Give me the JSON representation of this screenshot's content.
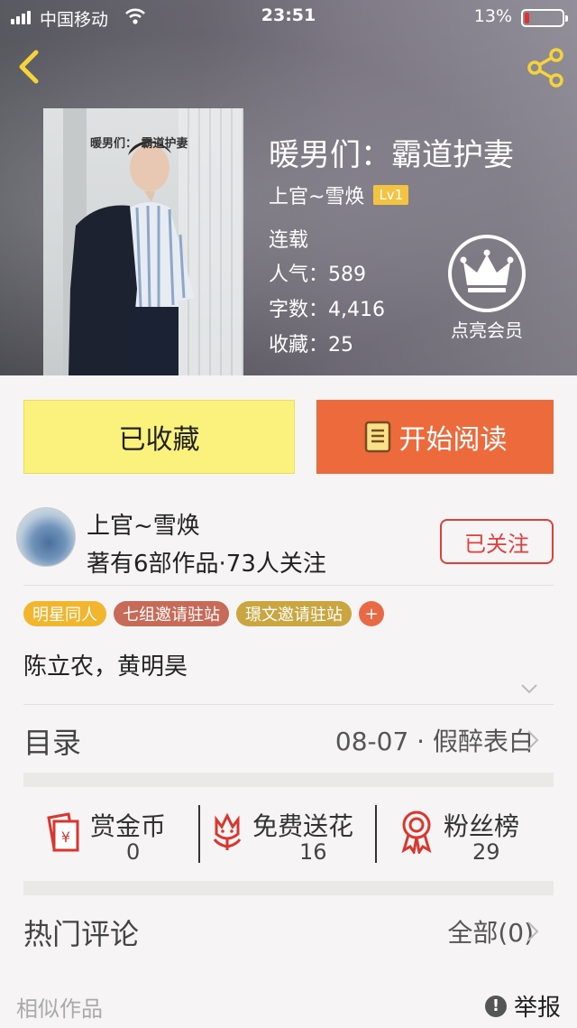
{
  "status_bar": {
    "carrier": "中国移动",
    "time": "23:51",
    "battery": "13%",
    "battery_level": 0.13
  },
  "book": {
    "title": "暖男们：霸道护妻",
    "cover_text": "暖男们： 霸道护妻",
    "author": "上官~雪焕",
    "level": "Lv1",
    "status": "连载",
    "popularity": "人气：589",
    "word_count": "字数：4,416",
    "favorites": "收藏：25"
  },
  "vip": {
    "label": "点亮会员"
  },
  "actions": {
    "collect_label": "已收藏",
    "read_label": "开始阅读"
  },
  "author_card": {
    "name": "上官~雪焕",
    "stats": "著有6部作品·73人关注",
    "follow_label": "已关注"
  },
  "tags": [
    {
      "label": "明星同人",
      "color": "#f2b52e"
    },
    {
      "label": "七组邀请驻站",
      "color": "#c86a58"
    },
    {
      "label": "璟文邀请驻站",
      "color": "#c9a640"
    }
  ],
  "tag_add": "+",
  "characters": "陈立农，黄明昊",
  "toc": {
    "label": "目录",
    "latest": "08-07 · 假醉表白"
  },
  "stats": {
    "reward": {
      "label": "赏金币",
      "value": "0"
    },
    "flowers": {
      "label": "免费送花",
      "value": "16"
    },
    "fans": {
      "label": "粉丝榜",
      "value": "29"
    }
  },
  "hot_comments": {
    "label": "热门评论",
    "all_label": "全部(0)"
  },
  "footer": {
    "similar_label": "相似作品",
    "report_label": "举报"
  },
  "colors": {
    "accent_orange": "#ec6a3c",
    "collect_yellow": "#fbf27e",
    "follow_red": "#e0403a",
    "icon_red": "#d9362f"
  }
}
